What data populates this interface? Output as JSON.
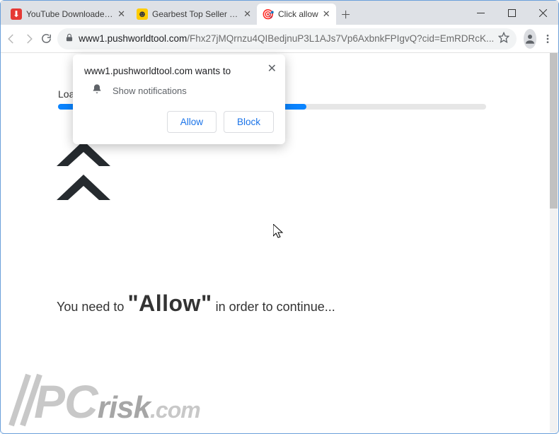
{
  "tabs": [
    {
      "title": "YouTube Downloader - Do"
    },
    {
      "title": "Gearbest Top Seller - Dive"
    },
    {
      "title": "Click allow"
    }
  ],
  "url": {
    "domain": "www1.pushworldtool.com",
    "path": "/Fhx27jMQrnzu4QIBedjnuP3L1AJs7Vp6AxbnkFPIgvQ?cid=EmRDRcK..."
  },
  "notif": {
    "origin": "www1.pushworldtool.com wants to",
    "label": "Show notifications",
    "allow": "Allow",
    "block": "Block"
  },
  "page": {
    "loading": "Loading...",
    "msg_pre": "You need to ",
    "msg_allow": "\"Allow\"",
    "msg_post": " in order to continue..."
  },
  "watermark": {
    "pc": "PC",
    "risk": "risk",
    "com": ".com"
  }
}
